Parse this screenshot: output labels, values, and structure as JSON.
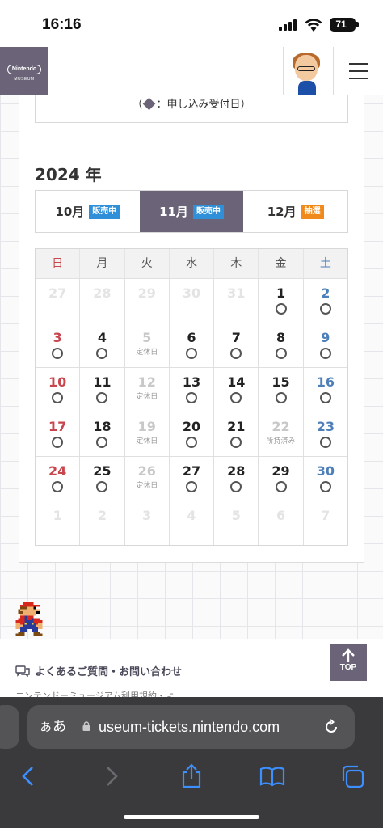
{
  "status_bar": {
    "time": "16:16",
    "battery": "71"
  },
  "header": {
    "logo_text": "Nintendo",
    "logo_sub": "MUSEUM",
    "avatar_icon": "mii-avatar-icon",
    "menu_icon": "hamburger-menu-icon"
  },
  "legend": {
    "text": "：申し込み受付日）",
    "prefix": "（"
  },
  "calendar": {
    "year": "2024 年",
    "tabs": [
      {
        "month": "10月",
        "badge": "販売中",
        "badge_color": "#2f8fd8",
        "active": false
      },
      {
        "month": "11月",
        "badge": "販売中",
        "badge_color": "#2f8fd8",
        "active": true
      },
      {
        "month": "12月",
        "badge": "抽選",
        "badge_color": "#f08a1c",
        "active": false
      }
    ],
    "weekdays": [
      "日",
      "月",
      "火",
      "水",
      "木",
      "金",
      "土"
    ],
    "weekday_colors": {
      "sun": "#c8464d",
      "sat": "#4d7fb8"
    },
    "weeks": [
      [
        {
          "n": "27",
          "state": "faded"
        },
        {
          "n": "28",
          "state": "faded"
        },
        {
          "n": "29",
          "state": "faded"
        },
        {
          "n": "30",
          "state": "faded"
        },
        {
          "n": "31",
          "state": "faded"
        },
        {
          "n": "1",
          "state": "open"
        },
        {
          "n": "2",
          "state": "open"
        }
      ],
      [
        {
          "n": "3",
          "state": "open"
        },
        {
          "n": "4",
          "state": "open"
        },
        {
          "n": "5",
          "state": "closed",
          "note": "定休日"
        },
        {
          "n": "6",
          "state": "open"
        },
        {
          "n": "7",
          "state": "open"
        },
        {
          "n": "8",
          "state": "open"
        },
        {
          "n": "9",
          "state": "open"
        }
      ],
      [
        {
          "n": "10",
          "state": "open"
        },
        {
          "n": "11",
          "state": "open"
        },
        {
          "n": "12",
          "state": "closed",
          "note": "定休日"
        },
        {
          "n": "13",
          "state": "open"
        },
        {
          "n": "14",
          "state": "open"
        },
        {
          "n": "15",
          "state": "open"
        },
        {
          "n": "16",
          "state": "open"
        }
      ],
      [
        {
          "n": "17",
          "state": "open"
        },
        {
          "n": "18",
          "state": "open"
        },
        {
          "n": "19",
          "state": "closed",
          "note": "定休日"
        },
        {
          "n": "20",
          "state": "open"
        },
        {
          "n": "21",
          "state": "open"
        },
        {
          "n": "22",
          "state": "closed",
          "note": "所持済み"
        },
        {
          "n": "23",
          "state": "open"
        }
      ],
      [
        {
          "n": "24",
          "state": "open"
        },
        {
          "n": "25",
          "state": "open"
        },
        {
          "n": "26",
          "state": "closed",
          "note": "定休日"
        },
        {
          "n": "27",
          "state": "open"
        },
        {
          "n": "28",
          "state": "open"
        },
        {
          "n": "29",
          "state": "open"
        },
        {
          "n": "30",
          "state": "open"
        }
      ],
      [
        {
          "n": "1",
          "state": "faded"
        },
        {
          "n": "2",
          "state": "faded"
        },
        {
          "n": "3",
          "state": "faded"
        },
        {
          "n": "4",
          "state": "faded"
        },
        {
          "n": "5",
          "state": "faded"
        },
        {
          "n": "6",
          "state": "faded"
        },
        {
          "n": "7",
          "state": "faded"
        }
      ]
    ]
  },
  "footer": {
    "faq_label": "よくあるご質問・お問い合わせ",
    "cut_text": "ニンテンドーミュージアム利用規約・よ",
    "top_label": "TOP"
  },
  "browser": {
    "aa_label": "ぁあ",
    "url": "useum-tickets.nintendo.com"
  },
  "colors": {
    "accent": "#6b6478",
    "sale_badge": "#2f8fd8",
    "lottery_badge": "#f08a1c"
  }
}
